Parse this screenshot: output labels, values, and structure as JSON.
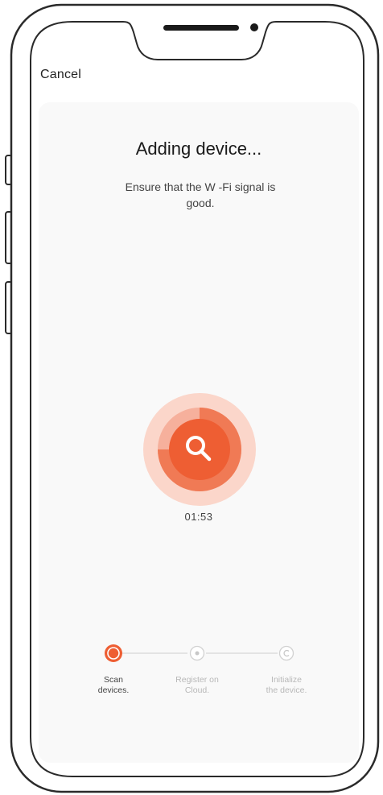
{
  "nav": {
    "cancel_label": "Cancel"
  },
  "main": {
    "title": "Adding device...",
    "subtitle_line1": "Ensure that the W -Fi signal is",
    "subtitle_line2": "good.",
    "timer": "01:53",
    "progress": 0.75
  },
  "steps": [
    {
      "line1": "Scan",
      "line2": "devices.",
      "state": "active"
    },
    {
      "line1": "Register on",
      "line2": "Cloud.",
      "state": "pending"
    },
    {
      "line1": "Initialize",
      "line2": "the device.",
      "state": "pending"
    }
  ],
  "colors": {
    "accent": "#ee5e33",
    "accent_ring": "#f6b09c",
    "accent_ring_light": "#fbd6ca",
    "pending": "#cfcfcf"
  },
  "icons": {
    "scan": "search-icon"
  }
}
